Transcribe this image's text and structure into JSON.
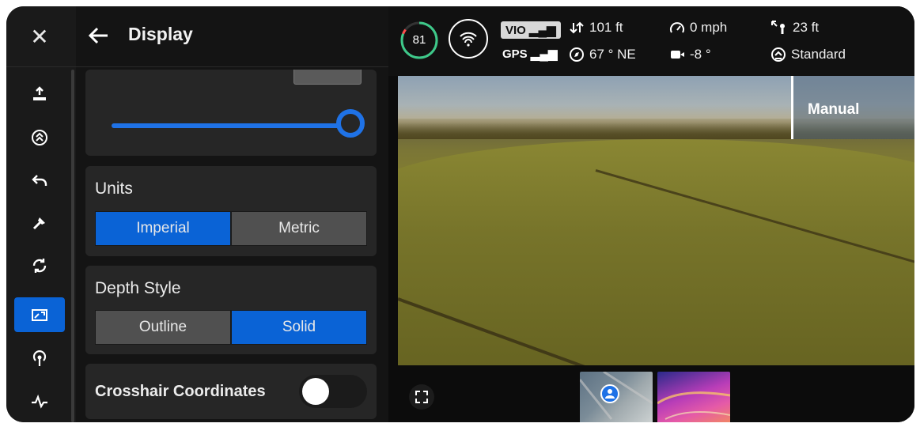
{
  "header": {
    "title": "Display"
  },
  "rail": {
    "items": [
      {
        "icon": "takeoff-icon"
      },
      {
        "icon": "flight-mode-icon"
      },
      {
        "icon": "return-home-icon"
      },
      {
        "icon": "drone-light-icon"
      },
      {
        "icon": "sync-icon"
      },
      {
        "icon": "display-icon",
        "active": true
      },
      {
        "icon": "connectivity-icon"
      },
      {
        "icon": "activity-icon"
      }
    ]
  },
  "units": {
    "label": "Units",
    "options": [
      "Imperial",
      "Metric"
    ],
    "selected": "Imperial"
  },
  "depth_style": {
    "label": "Depth Style",
    "options": [
      "Outline",
      "Solid"
    ],
    "selected": "Solid"
  },
  "crosshair": {
    "label": "Crosshair Coordinates",
    "enabled": false
  },
  "brightness_slider": {
    "level": 1.0
  },
  "telemetry": {
    "battery": "81",
    "vio": "VIO",
    "gps": "GPS",
    "altitude": "101 ft",
    "heading": "67 ° NE",
    "speed": "0 mph",
    "gimbal": "-8 °",
    "distance": "23 ft",
    "mode": "Standard"
  },
  "camera": {
    "mode_label": "Manual"
  },
  "colors": {
    "accent": "#0a63d6",
    "panel": "#262626",
    "battery_ring": "#3ec98a"
  }
}
